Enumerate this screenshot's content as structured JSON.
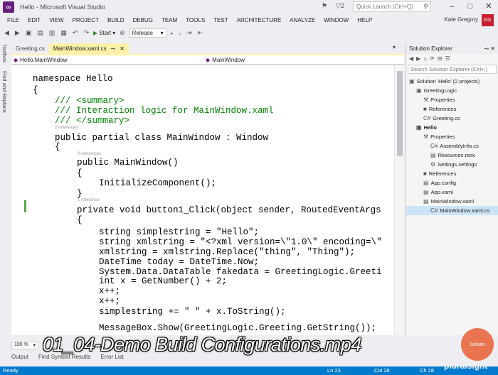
{
  "window": {
    "title": "Hello - Microsoft Visual Studio",
    "notif_count": "2",
    "quick_launch": "Quick Launch (Ctrl+Q)"
  },
  "menu": [
    "FILE",
    "EDIT",
    "VIEW",
    "PROJECT",
    "BUILD",
    "DEBUG",
    "TEAM",
    "TOOLS",
    "TEST",
    "ARCHITECTURE",
    "ANALYZE",
    "WINDOW",
    "HELP"
  ],
  "user": {
    "name": "Kate Gregory",
    "initials": "KG"
  },
  "toolbar": {
    "start_label": "Start",
    "config": "Release"
  },
  "left_strip": [
    "Toolbox",
    "Find and Replace"
  ],
  "tabs": [
    {
      "label": "Greeting.cs",
      "active": false
    },
    {
      "label": "MainWindow.xaml.cs",
      "active": true
    }
  ],
  "nav": {
    "project": "Hello.MainWindow",
    "member": "MainWindow"
  },
  "code": [
    {
      "t": "namespace Hello",
      "k": "ns"
    },
    {
      "t": "{",
      "k": "plain"
    },
    {
      "t": "/// <summary>",
      "k": "cm"
    },
    {
      "t": "/// Interaction logic for MainWindow.xaml",
      "k": "cm"
    },
    {
      "t": "/// </summary>",
      "k": "cm"
    },
    {
      "t": "public partial class MainWindow : Window",
      "k": "cls"
    },
    {
      "t": "{",
      "k": "plain"
    },
    {
      "t": "public MainWindow()",
      "k": "ctor"
    },
    {
      "t": "{",
      "k": "plain"
    },
    {
      "t": "InitializeComponent();",
      "k": "plain"
    },
    {
      "t": "}",
      "k": "plain"
    },
    {
      "t": "private void button1_Click(object sender, RoutedEventArgs",
      "k": "meth"
    },
    {
      "t": "{",
      "k": "plain"
    },
    {
      "t": "string simplestring = \"Hello\";",
      "k": "s1"
    },
    {
      "t": "string xmlstring = \"<?xml version=\\\"1.0\\\" encoding=\\\"",
      "k": "s2"
    },
    {
      "t": "xmlstring = xmlstring.Replace(\"thing\", \"Thing\");",
      "k": "s3"
    },
    {
      "t": "DateTime today = DateTime.Now;",
      "k": "dt"
    },
    {
      "t": "System.Data.DataTable fakedata = GreetingLogic.Greeti",
      "k": "sd"
    },
    {
      "t": "int x = GetNumber() + 2;",
      "k": "int"
    },
    {
      "t": "x++;",
      "k": "plain"
    },
    {
      "t": "x++;",
      "k": "plain"
    },
    {
      "t": "simplestring += \" \" + x.ToString();",
      "k": "s4"
    },
    {
      "t": "MessageBox.Show(GreetingLogic.Greeting.GetString());",
      "k": "mb"
    }
  ],
  "lens": {
    "class_refs": "2 references",
    "ctor_refs": "0 references",
    "method_refs": "1 reference"
  },
  "zoom": "100 %",
  "solution_explorer": {
    "title": "Solution Explorer",
    "search": "Search Solution Explorer (Ctrl+;)",
    "items": [
      {
        "label": "Solution 'Hello' (2 projects)",
        "icon": "solution-icon",
        "bold": false
      },
      {
        "label": "GreetingLogic",
        "icon": "csproj-icon",
        "bold": false
      },
      {
        "label": "Properties",
        "icon": "wrench-icon",
        "bold": false
      },
      {
        "label": "References",
        "icon": "references-icon",
        "bold": false
      },
      {
        "label": "Greeting.cs",
        "icon": "cs-file-icon",
        "bold": false
      },
      {
        "label": "Hello",
        "icon": "csproj-icon",
        "bold": true
      },
      {
        "label": "Properties",
        "icon": "wrench-icon",
        "bold": false
      },
      {
        "label": "AssemblyInfo.cs",
        "icon": "cs-file-icon",
        "bold": false
      },
      {
        "label": "Resources.resx",
        "icon": "resx-icon",
        "bold": false
      },
      {
        "label": "Settings.settings",
        "icon": "settings-icon",
        "bold": false
      },
      {
        "label": "References",
        "icon": "references-icon",
        "bold": false
      },
      {
        "label": "App.config",
        "icon": "config-icon",
        "bold": false
      },
      {
        "label": "App.xaml",
        "icon": "xaml-icon",
        "bold": false
      },
      {
        "label": "MainWindow.xaml",
        "icon": "xaml-icon",
        "bold": false
      },
      {
        "label": "MainWindow.xaml.cs",
        "icon": "cs-file-icon",
        "bold": false
      }
    ]
  },
  "bottom_tabs": [
    "Output",
    "Find Symbol Results",
    "Error List"
  ],
  "status": {
    "left": "Ready",
    "ln": "Ln 23",
    "col": "Col 28",
    "ch": "Ch 28"
  },
  "overlay": {
    "caption": "01_04-Demo Build Configurations.mp4",
    "brand": "pluralsight",
    "circle_text": "Solutio"
  }
}
